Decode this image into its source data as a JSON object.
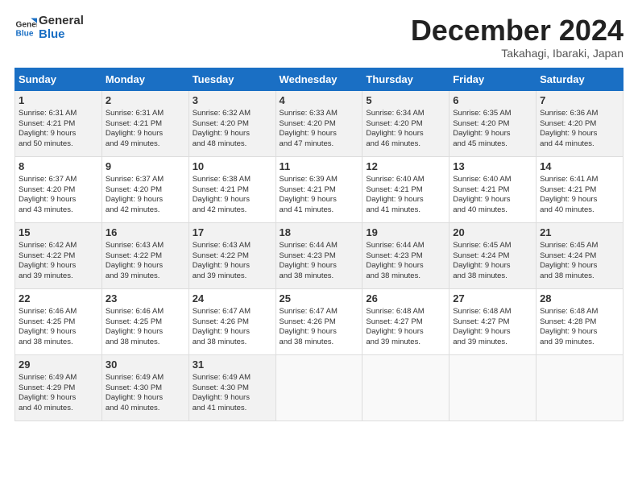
{
  "header": {
    "logo_line1": "General",
    "logo_line2": "Blue",
    "month": "December 2024",
    "location": "Takahagi, Ibaraki, Japan"
  },
  "weekdays": [
    "Sunday",
    "Monday",
    "Tuesday",
    "Wednesday",
    "Thursday",
    "Friday",
    "Saturday"
  ],
  "weeks": [
    [
      {
        "day": "1",
        "sunrise": "Sunrise: 6:31 AM",
        "sunset": "Sunset: 4:21 PM",
        "daylight": "Daylight: 9 hours and 50 minutes."
      },
      {
        "day": "2",
        "sunrise": "Sunrise: 6:31 AM",
        "sunset": "Sunset: 4:21 PM",
        "daylight": "Daylight: 9 hours and 49 minutes."
      },
      {
        "day": "3",
        "sunrise": "Sunrise: 6:32 AM",
        "sunset": "Sunset: 4:20 PM",
        "daylight": "Daylight: 9 hours and 48 minutes."
      },
      {
        "day": "4",
        "sunrise": "Sunrise: 6:33 AM",
        "sunset": "Sunset: 4:20 PM",
        "daylight": "Daylight: 9 hours and 47 minutes."
      },
      {
        "day": "5",
        "sunrise": "Sunrise: 6:34 AM",
        "sunset": "Sunset: 4:20 PM",
        "daylight": "Daylight: 9 hours and 46 minutes."
      },
      {
        "day": "6",
        "sunrise": "Sunrise: 6:35 AM",
        "sunset": "Sunset: 4:20 PM",
        "daylight": "Daylight: 9 hours and 45 minutes."
      },
      {
        "day": "7",
        "sunrise": "Sunrise: 6:36 AM",
        "sunset": "Sunset: 4:20 PM",
        "daylight": "Daylight: 9 hours and 44 minutes."
      }
    ],
    [
      {
        "day": "8",
        "sunrise": "Sunrise: 6:37 AM",
        "sunset": "Sunset: 4:20 PM",
        "daylight": "Daylight: 9 hours and 43 minutes."
      },
      {
        "day": "9",
        "sunrise": "Sunrise: 6:37 AM",
        "sunset": "Sunset: 4:20 PM",
        "daylight": "Daylight: 9 hours and 42 minutes."
      },
      {
        "day": "10",
        "sunrise": "Sunrise: 6:38 AM",
        "sunset": "Sunset: 4:21 PM",
        "daylight": "Daylight: 9 hours and 42 minutes."
      },
      {
        "day": "11",
        "sunrise": "Sunrise: 6:39 AM",
        "sunset": "Sunset: 4:21 PM",
        "daylight": "Daylight: 9 hours and 41 minutes."
      },
      {
        "day": "12",
        "sunrise": "Sunrise: 6:40 AM",
        "sunset": "Sunset: 4:21 PM",
        "daylight": "Daylight: 9 hours and 41 minutes."
      },
      {
        "day": "13",
        "sunrise": "Sunrise: 6:40 AM",
        "sunset": "Sunset: 4:21 PM",
        "daylight": "Daylight: 9 hours and 40 minutes."
      },
      {
        "day": "14",
        "sunrise": "Sunrise: 6:41 AM",
        "sunset": "Sunset: 4:21 PM",
        "daylight": "Daylight: 9 hours and 40 minutes."
      }
    ],
    [
      {
        "day": "15",
        "sunrise": "Sunrise: 6:42 AM",
        "sunset": "Sunset: 4:22 PM",
        "daylight": "Daylight: 9 hours and 39 minutes."
      },
      {
        "day": "16",
        "sunrise": "Sunrise: 6:43 AM",
        "sunset": "Sunset: 4:22 PM",
        "daylight": "Daylight: 9 hours and 39 minutes."
      },
      {
        "day": "17",
        "sunrise": "Sunrise: 6:43 AM",
        "sunset": "Sunset: 4:22 PM",
        "daylight": "Daylight: 9 hours and 39 minutes."
      },
      {
        "day": "18",
        "sunrise": "Sunrise: 6:44 AM",
        "sunset": "Sunset: 4:23 PM",
        "daylight": "Daylight: 9 hours and 38 minutes."
      },
      {
        "day": "19",
        "sunrise": "Sunrise: 6:44 AM",
        "sunset": "Sunset: 4:23 PM",
        "daylight": "Daylight: 9 hours and 38 minutes."
      },
      {
        "day": "20",
        "sunrise": "Sunrise: 6:45 AM",
        "sunset": "Sunset: 4:24 PM",
        "daylight": "Daylight: 9 hours and 38 minutes."
      },
      {
        "day": "21",
        "sunrise": "Sunrise: 6:45 AM",
        "sunset": "Sunset: 4:24 PM",
        "daylight": "Daylight: 9 hours and 38 minutes."
      }
    ],
    [
      {
        "day": "22",
        "sunrise": "Sunrise: 6:46 AM",
        "sunset": "Sunset: 4:25 PM",
        "daylight": "Daylight: 9 hours and 38 minutes."
      },
      {
        "day": "23",
        "sunrise": "Sunrise: 6:46 AM",
        "sunset": "Sunset: 4:25 PM",
        "daylight": "Daylight: 9 hours and 38 minutes."
      },
      {
        "day": "24",
        "sunrise": "Sunrise: 6:47 AM",
        "sunset": "Sunset: 4:26 PM",
        "daylight": "Daylight: 9 hours and 38 minutes."
      },
      {
        "day": "25",
        "sunrise": "Sunrise: 6:47 AM",
        "sunset": "Sunset: 4:26 PM",
        "daylight": "Daylight: 9 hours and 38 minutes."
      },
      {
        "day": "26",
        "sunrise": "Sunrise: 6:48 AM",
        "sunset": "Sunset: 4:27 PM",
        "daylight": "Daylight: 9 hours and 39 minutes."
      },
      {
        "day": "27",
        "sunrise": "Sunrise: 6:48 AM",
        "sunset": "Sunset: 4:27 PM",
        "daylight": "Daylight: 9 hours and 39 minutes."
      },
      {
        "day": "28",
        "sunrise": "Sunrise: 6:48 AM",
        "sunset": "Sunset: 4:28 PM",
        "daylight": "Daylight: 9 hours and 39 minutes."
      }
    ],
    [
      {
        "day": "29",
        "sunrise": "Sunrise: 6:49 AM",
        "sunset": "Sunset: 4:29 PM",
        "daylight": "Daylight: 9 hours and 40 minutes."
      },
      {
        "day": "30",
        "sunrise": "Sunrise: 6:49 AM",
        "sunset": "Sunset: 4:30 PM",
        "daylight": "Daylight: 9 hours and 40 minutes."
      },
      {
        "day": "31",
        "sunrise": "Sunrise: 6:49 AM",
        "sunset": "Sunset: 4:30 PM",
        "daylight": "Daylight: 9 hours and 41 minutes."
      },
      null,
      null,
      null,
      null
    ]
  ]
}
